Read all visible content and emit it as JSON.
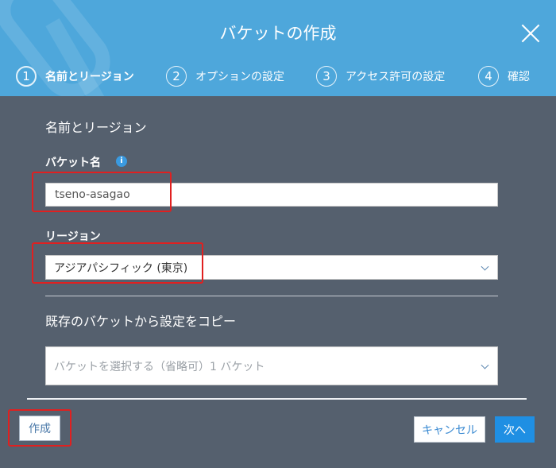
{
  "dialog": {
    "title": "バケットの作成",
    "close_icon": "close-icon"
  },
  "steps": [
    {
      "number": "1",
      "label": "名前とリージョン",
      "active": true
    },
    {
      "number": "2",
      "label": "オプションの設定",
      "active": false
    },
    {
      "number": "3",
      "label": "アクセス許可の設定",
      "active": false
    },
    {
      "number": "4",
      "label": "確認",
      "active": false
    }
  ],
  "form": {
    "section_title": "名前とリージョン",
    "bucket_name_label": "バケット名",
    "bucket_name_info_icon": "info-icon",
    "bucket_name_value": "tseno-asagao",
    "region_label": "リージョン",
    "region_value": "アジアパシフィック (東京)",
    "copy_section_title": "既存のバケットから設定をコピー",
    "copy_select_placeholder": "バケットを選択する（省略可）1 バケット"
  },
  "footer": {
    "create_label": "作成",
    "cancel_label": "キャンセル",
    "next_label": "次へ"
  },
  "colors": {
    "header_bg": "#4ea7db",
    "body_bg": "#55606e",
    "primary_button": "#1f8fe3",
    "highlight": "#e02020"
  }
}
